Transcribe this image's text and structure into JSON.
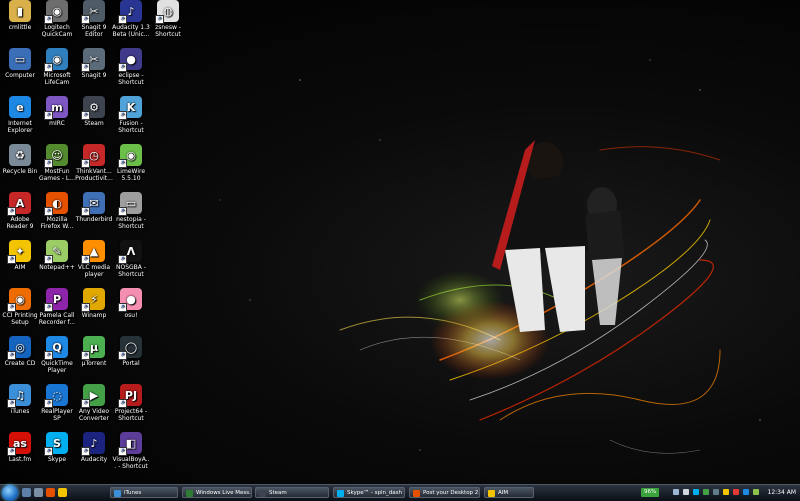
{
  "desktop": {
    "icons": [
      {
        "name": "cmlittle-icon",
        "label": "cmlittle",
        "col": 0,
        "row": 0,
        "color": "#d9b04a",
        "glyph": "▮"
      },
      {
        "name": "computer-icon",
        "label": "Computer",
        "col": 0,
        "row": 1,
        "color": "#3a6fb8",
        "glyph": "▭"
      },
      {
        "name": "internet-explorer-icon",
        "label": "Internet Explorer",
        "col": 0,
        "row": 2,
        "color": "#1e88e5",
        "glyph": "e"
      },
      {
        "name": "recycle-bin-icon",
        "label": "Recycle Bin",
        "col": 0,
        "row": 3,
        "color": "#7a8a99",
        "glyph": "♻"
      },
      {
        "name": "adobe-reader-icon",
        "label": "Adobe Reader 9",
        "col": 0,
        "row": 4,
        "color": "#c62828",
        "glyph": "A",
        "shortcut": true
      },
      {
        "name": "aim-icon",
        "label": "AIM",
        "col": 0,
        "row": 5,
        "color": "#f4c400",
        "glyph": "✦",
        "shortcut": true
      },
      {
        "name": "cci-printing-setup-icon",
        "label": "CCI Printing Setup",
        "col": 0,
        "row": 6,
        "color": "#ef6c00",
        "glyph": "◉",
        "shortcut": true
      },
      {
        "name": "create-cd-icon",
        "label": "Create CD",
        "col": 0,
        "row": 7,
        "color": "#1565c0",
        "glyph": "◎",
        "shortcut": true
      },
      {
        "name": "itunes-icon",
        "label": "iTunes",
        "col": 0,
        "row": 8,
        "color": "#3b8fd8",
        "glyph": "♫",
        "shortcut": true
      },
      {
        "name": "lastfm-icon",
        "label": "Last.fm",
        "col": 0,
        "row": 9,
        "color": "#d51007",
        "glyph": "as",
        "shortcut": true
      },
      {
        "name": "logitech-quickcam-icon",
        "label": "Logitech QuickCam",
        "col": 1,
        "row": 0,
        "color": "#6d6d6d",
        "glyph": "◉",
        "shortcut": true
      },
      {
        "name": "microsoft-lifecam-icon",
        "label": "Microsoft LifeCam",
        "col": 1,
        "row": 1,
        "color": "#2f7fbf",
        "glyph": "◉",
        "shortcut": true
      },
      {
        "name": "mirc-icon",
        "label": "mIRC",
        "col": 1,
        "row": 2,
        "color": "#7e57c2",
        "glyph": "m",
        "shortcut": true
      },
      {
        "name": "mostfun-games-icon",
        "label": "MostFun Games - L...",
        "col": 1,
        "row": 3,
        "color": "#558b2f",
        "glyph": "☺",
        "shortcut": true
      },
      {
        "name": "mozilla-firefox-icon",
        "label": "Mozilla Firefox W...",
        "col": 1,
        "row": 4,
        "color": "#e65100",
        "glyph": "◐",
        "shortcut": true
      },
      {
        "name": "notepad-plus-icon",
        "label": "Notepad++",
        "col": 1,
        "row": 5,
        "color": "#9ccc65",
        "glyph": "✎",
        "shortcut": true
      },
      {
        "name": "pamela-call-recorder-icon",
        "label": "Pamela Call Recorder f...",
        "col": 1,
        "row": 6,
        "color": "#8e24aa",
        "glyph": "P",
        "shortcut": true
      },
      {
        "name": "quicktime-player-icon",
        "label": "QuickTime Player",
        "col": 1,
        "row": 7,
        "color": "#1e88e5",
        "glyph": "Q",
        "shortcut": true
      },
      {
        "name": "realplayer-sp-icon",
        "label": "RealPlayer SP",
        "col": 1,
        "row": 8,
        "color": "#1976d2",
        "glyph": "◌",
        "shortcut": true
      },
      {
        "name": "skype-icon",
        "label": "Skype",
        "col": 1,
        "row": 9,
        "color": "#00aff0",
        "glyph": "S",
        "shortcut": true
      },
      {
        "name": "snagit-editor-icon",
        "label": "Snagit 9 Editor",
        "col": 2,
        "row": 0,
        "color": "#4f5b66",
        "glyph": "✂",
        "shortcut": true
      },
      {
        "name": "snagit-icon",
        "label": "Snagit 9",
        "col": 2,
        "row": 1,
        "color": "#5b6b7a",
        "glyph": "✂",
        "shortcut": true
      },
      {
        "name": "steam-icon",
        "label": "Steam",
        "col": 2,
        "row": 2,
        "color": "#3d4450",
        "glyph": "⚙",
        "shortcut": true
      },
      {
        "name": "thinkvantage-icon",
        "label": "ThinkVant... Productivit...",
        "col": 2,
        "row": 3,
        "color": "#c62828",
        "glyph": "◷",
        "shortcut": true
      },
      {
        "name": "thunderbird-icon",
        "label": "Thunderbird",
        "col": 2,
        "row": 4,
        "color": "#3f6fb5",
        "glyph": "✉",
        "shortcut": true
      },
      {
        "name": "vlc-media-player-icon",
        "label": "VLC media player",
        "col": 2,
        "row": 5,
        "color": "#ff8f00",
        "glyph": "▲",
        "shortcut": true
      },
      {
        "name": "winamp-icon",
        "label": "Winamp",
        "col": 2,
        "row": 6,
        "color": "#e0a800",
        "glyph": "⚡",
        "shortcut": true
      },
      {
        "name": "utorrent-icon",
        "label": "µTorrent",
        "col": 2,
        "row": 7,
        "color": "#4caf50",
        "glyph": "µ",
        "shortcut": true
      },
      {
        "name": "any-video-converter-icon",
        "label": "Any Video Converter",
        "col": 2,
        "row": 8,
        "color": "#43a047",
        "glyph": "▶",
        "shortcut": true
      },
      {
        "name": "audacity-icon",
        "label": "Audacity",
        "col": 2,
        "row": 9,
        "color": "#1a237e",
        "glyph": "♪",
        "shortcut": true
      },
      {
        "name": "audacity-beta-icon",
        "label": "Audacity 1.3 Beta (Unic...",
        "col": 3,
        "row": 0,
        "color": "#283593",
        "glyph": "♪",
        "shortcut": true
      },
      {
        "name": "eclipse-icon",
        "label": "eclipse - Shortcut",
        "col": 3,
        "row": 1,
        "color": "#3f3a8a",
        "glyph": "●",
        "shortcut": true
      },
      {
        "name": "fusion-icon",
        "label": "Fusion - Shortcut",
        "col": 3,
        "row": 2,
        "color": "#4fa3d9",
        "glyph": "K",
        "shortcut": true
      },
      {
        "name": "limewire-icon",
        "label": "LimeWire 5.5.10",
        "col": 3,
        "row": 3,
        "color": "#6cc04a",
        "glyph": "◉",
        "shortcut": true
      },
      {
        "name": "nestopia-icon",
        "label": "nestopia - Shortcut",
        "col": 3,
        "row": 4,
        "color": "#9e9e9e",
        "glyph": "▭",
        "shortcut": true
      },
      {
        "name": "nosgba-icon",
        "label": "NOSGBA - Shortcut",
        "col": 3,
        "row": 5,
        "color": "#111111",
        "glyph": "Λ",
        "shortcut": true
      },
      {
        "name": "osu-icon",
        "label": "osu!",
        "col": 3,
        "row": 6,
        "color": "#f48fb1",
        "glyph": "●",
        "shortcut": true
      },
      {
        "name": "portal-icon",
        "label": "Portal",
        "col": 3,
        "row": 7,
        "color": "#263238",
        "glyph": "◯",
        "shortcut": true
      },
      {
        "name": "project64-icon",
        "label": "Project64 - Shortcut",
        "col": 3,
        "row": 8,
        "color": "#b71c1c",
        "glyph": "PJ",
        "shortcut": true
      },
      {
        "name": "visualboyadvance-icon",
        "label": "VisualBoyA... - Shortcut",
        "col": 3,
        "row": 9,
        "color": "#5c3d99",
        "glyph": "◧",
        "shortcut": true
      },
      {
        "name": "zsnesw-icon",
        "label": "zsnesw - Shortcut",
        "col": 4,
        "row": 0,
        "color": "#e0e0e0",
        "glyph": "◍",
        "shortcut": true
      }
    ]
  },
  "taskbar": {
    "tasks": [
      {
        "name": "task-itunes",
        "label": "iTunes",
        "color": "#3b8fd8"
      },
      {
        "name": "task-windows-live-messenger",
        "label": "Windows Live Mess...",
        "color": "#2e7d32"
      },
      {
        "name": "task-steam",
        "label": "Steam",
        "color": "#3d4450"
      },
      {
        "name": "task-skype",
        "label": "Skype™ - spin_dash",
        "color": "#00aff0"
      },
      {
        "name": "task-post-desktop",
        "label": "Post your Desktop 2...",
        "color": "#e65100"
      },
      {
        "name": "task-aim",
        "label": "AIM",
        "color": "#f4c400"
      }
    ],
    "battery": "96%",
    "clock": "12:34 AM"
  }
}
